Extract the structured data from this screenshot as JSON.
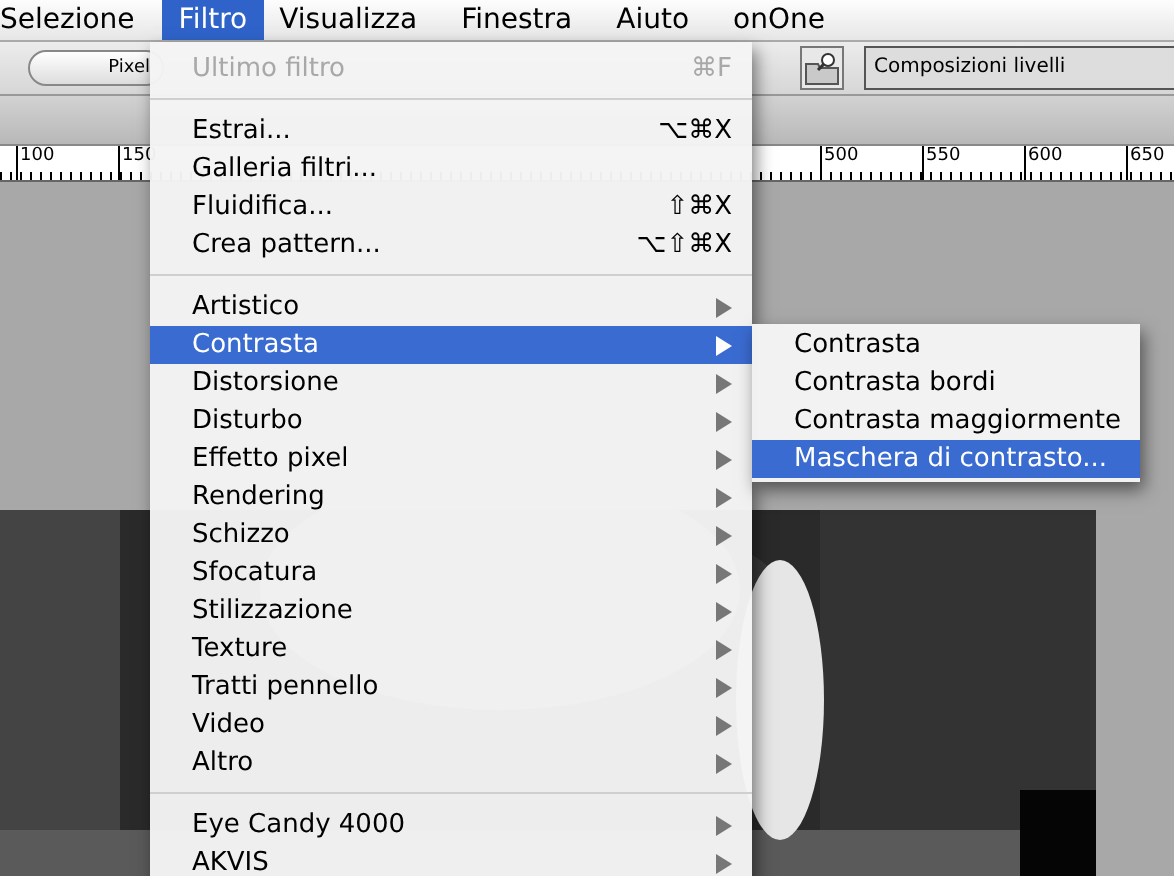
{
  "menu_bar": [
    {
      "label": "Selezione",
      "selected": false
    },
    {
      "label": "Filtro",
      "selected": true
    },
    {
      "label": "Visualizza",
      "selected": false
    },
    {
      "label": "Finestra",
      "selected": false
    },
    {
      "label": "Aiuto",
      "selected": false
    },
    {
      "label": "onOne",
      "selected": false
    }
  ],
  "toolbar": {
    "button": "Pixel",
    "panel_tab": "Composizioni livelli"
  },
  "ruler": {
    "left_labels": [
      "100",
      "150"
    ],
    "right_labels": [
      "500",
      "550",
      "600",
      "650"
    ]
  },
  "filter_menu": [
    {
      "kind": "item",
      "label": "Ultimo filtro",
      "shortcut": "⌘F",
      "disabled": true,
      "selected": false,
      "has_submenu": false
    },
    {
      "kind": "separator"
    },
    {
      "kind": "item",
      "label": "Estrai...",
      "shortcut": "⌥⌘X",
      "disabled": false,
      "selected": false,
      "has_submenu": false
    },
    {
      "kind": "item",
      "label": "Galleria filtri...",
      "disabled": false,
      "selected": false,
      "has_submenu": false
    },
    {
      "kind": "item",
      "label": "Fluidifica...",
      "shortcut": "⇧⌘X",
      "disabled": false,
      "selected": false,
      "has_submenu": false
    },
    {
      "kind": "item",
      "label": "Crea pattern...",
      "shortcut": "⌥⇧⌘X",
      "disabled": false,
      "selected": false,
      "has_submenu": false
    },
    {
      "kind": "separator"
    },
    {
      "kind": "item",
      "label": "Artistico",
      "disabled": false,
      "selected": false,
      "has_submenu": true
    },
    {
      "kind": "item",
      "label": "Contrasta",
      "disabled": false,
      "selected": true,
      "has_submenu": true
    },
    {
      "kind": "item",
      "label": "Distorsione",
      "disabled": false,
      "selected": false,
      "has_submenu": true
    },
    {
      "kind": "item",
      "label": "Disturbo",
      "disabled": false,
      "selected": false,
      "has_submenu": true
    },
    {
      "kind": "item",
      "label": "Effetto pixel",
      "disabled": false,
      "selected": false,
      "has_submenu": true
    },
    {
      "kind": "item",
      "label": "Rendering",
      "disabled": false,
      "selected": false,
      "has_submenu": true
    },
    {
      "kind": "item",
      "label": "Schizzo",
      "disabled": false,
      "selected": false,
      "has_submenu": true
    },
    {
      "kind": "item",
      "label": "Sfocatura",
      "disabled": false,
      "selected": false,
      "has_submenu": true
    },
    {
      "kind": "item",
      "label": "Stilizzazione",
      "disabled": false,
      "selected": false,
      "has_submenu": true
    },
    {
      "kind": "item",
      "label": "Texture",
      "disabled": false,
      "selected": false,
      "has_submenu": true
    },
    {
      "kind": "item",
      "label": "Tratti pennello",
      "disabled": false,
      "selected": false,
      "has_submenu": true
    },
    {
      "kind": "item",
      "label": "Video",
      "disabled": false,
      "selected": false,
      "has_submenu": true
    },
    {
      "kind": "item",
      "label": "Altro",
      "disabled": false,
      "selected": false,
      "has_submenu": true
    },
    {
      "kind": "separator"
    },
    {
      "kind": "item",
      "label": "Eye Candy 4000",
      "disabled": false,
      "selected": false,
      "has_submenu": true
    },
    {
      "kind": "item",
      "label": "AKVIS",
      "disabled": false,
      "selected": false,
      "has_submenu": true
    }
  ],
  "submenu": [
    {
      "label": "Contrasta",
      "selected": false
    },
    {
      "label": "Contrasta bordi",
      "selected": false
    },
    {
      "label": "Contrasta maggiormente",
      "selected": false
    },
    {
      "label": "Maschera di contrasto...",
      "selected": true
    }
  ]
}
